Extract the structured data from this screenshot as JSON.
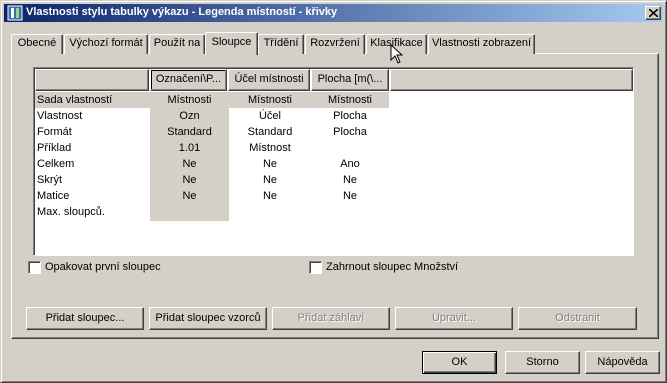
{
  "window": {
    "title": "Vlastnosti stylu tabulky výkazu - Legenda místností - křivky"
  },
  "tabs": [
    {
      "label": "Obecné",
      "active": false
    },
    {
      "label": "Výchozí formát",
      "active": false
    },
    {
      "label": "Použít na",
      "active": false
    },
    {
      "label": "Sloupce",
      "active": true
    },
    {
      "label": "Třídění",
      "active": false
    },
    {
      "label": "Rozvržení",
      "active": false
    },
    {
      "label": "Klasifikace",
      "active": false
    },
    {
      "label": "Vlastnosti zobrazení",
      "active": false
    }
  ],
  "grid": {
    "columns": [
      "Označení\\P...",
      "Účel místnosti",
      "Plocha [m(\\..."
    ],
    "rows": [
      {
        "label": "Sada vlastností",
        "values": [
          "Místnosti",
          "Místnosti",
          "Místnosti"
        ]
      },
      {
        "label": "Vlastnost",
        "values": [
          "Ozn",
          "Účel",
          "Plocha"
        ]
      },
      {
        "label": "Formát",
        "values": [
          "Standard",
          "Standard",
          "Plocha"
        ]
      },
      {
        "label": "Příklad",
        "values": [
          "1.01",
          "Místnost",
          ""
        ]
      },
      {
        "label": "Celkem",
        "values": [
          "Ne",
          "Ne",
          "Ano"
        ]
      },
      {
        "label": "Skrýt",
        "values": [
          "Ne",
          "Ne",
          "Ne"
        ]
      },
      {
        "label": "Matice",
        "values": [
          "Ne",
          "Ne",
          "Ne"
        ]
      },
      {
        "label": "Max. sloupců.",
        "values": [
          "",
          "",
          ""
        ]
      }
    ]
  },
  "options": {
    "repeat_first_column": "Opakovat první sloupec",
    "include_quantity_column": "Zahrnout sloupec Množství"
  },
  "actions": {
    "add_column": "Přidat sloupec...",
    "add_formula_column": "Přidat sloupec vzorců",
    "add_header": "Přidat záhlaví",
    "edit": "Upravit...",
    "remove": "Odstranit"
  },
  "footer": {
    "ok": "OK",
    "cancel": "Storno",
    "help": "Nápověda"
  }
}
